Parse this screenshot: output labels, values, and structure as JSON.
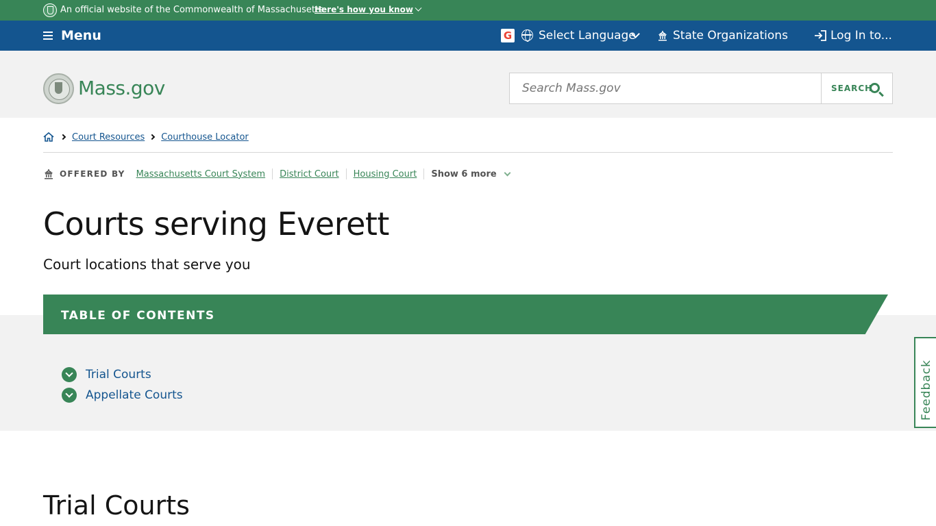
{
  "official_banner": {
    "text": "An official website of the Commonwealth of Massachusetts",
    "link": "Here's how you know"
  },
  "nav": {
    "menu": "Menu",
    "language": "Select Language",
    "organizations": "State Organizations",
    "login": "Log In to..."
  },
  "header": {
    "logo": "Mass.gov",
    "search_placeholder": "Search Mass.gov",
    "search_button": "SEARCH"
  },
  "breadcrumb": {
    "items": [
      "Court Resources",
      "Courthouse Locator"
    ]
  },
  "offered_by": {
    "label": "OFFERED BY",
    "links": [
      "Massachusetts Court System",
      "District Court",
      "Housing Court"
    ],
    "show_more": "Show 6 more"
  },
  "page": {
    "title": "Courts serving Everett",
    "subtitle": "Court locations that serve you"
  },
  "toc": {
    "title": "TABLE OF CONTENTS",
    "items": [
      "Trial Courts",
      "Appellate Courts"
    ]
  },
  "feedback": "Feedback",
  "section": {
    "title": "Trial Courts"
  },
  "colors": {
    "green": "#388557",
    "blue": "#14558f",
    "gray_bg": "#f2f2f2"
  }
}
